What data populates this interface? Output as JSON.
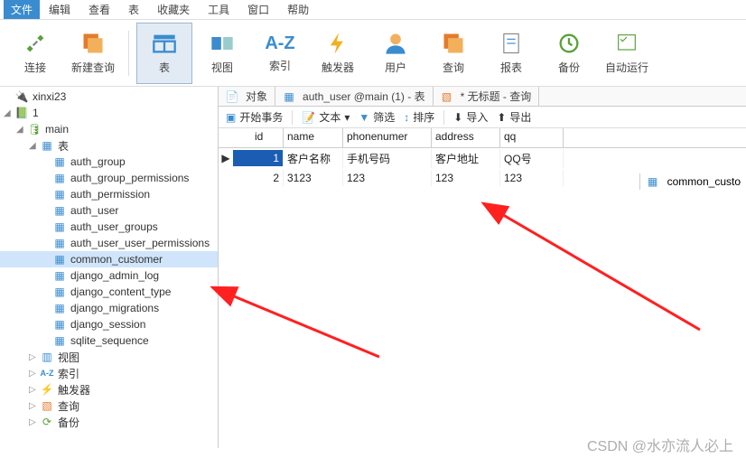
{
  "menu": {
    "file": "文件",
    "edit": "编辑",
    "view": "查看",
    "table": "表",
    "fav": "收藏夹",
    "tools": "工具",
    "window": "窗口",
    "help": "帮助"
  },
  "ribbon": {
    "connect": "连接",
    "newquery": "新建查询",
    "table": "表",
    "view": "视图",
    "atoz": "A-Z",
    "trigger": "触发器",
    "user": "用户",
    "query": "查询",
    "report": "报表",
    "backup": "备份",
    "autorun": "自动运行"
  },
  "tabs": {
    "object": "对象",
    "auth_user": "auth_user @main (1) - 表",
    "untitled": "* 无标题 - 查询",
    "right": "common_custo"
  },
  "tree": {
    "connection": "xinxi23",
    "db": "1",
    "schema": "main",
    "tables_label": "表",
    "tables": [
      "auth_group",
      "auth_group_permissions",
      "auth_permission",
      "auth_user",
      "auth_user_groups",
      "auth_user_user_permissions",
      "common_customer",
      "django_admin_log",
      "django_content_type",
      "django_migrations",
      "django_session",
      "sqlite_sequence"
    ],
    "views": "视图",
    "index": "索引",
    "trigger": "触发器",
    "query": "查询",
    "backup": "备份"
  },
  "toolbar": {
    "begin": "开始事务",
    "text": "文本",
    "filter": "筛选",
    "sort": "排序",
    "import": "导入",
    "export": "导出"
  },
  "grid": {
    "headers": {
      "id": "id",
      "name": "name",
      "phone": "phonenumer",
      "address": "address",
      "qq": "qq"
    },
    "rows": [
      {
        "id": "1",
        "name": "客户名称",
        "phone": "手机号码",
        "address": "客户地址",
        "qq": "QQ号"
      },
      {
        "id": "2",
        "name": "3123",
        "phone": "123",
        "address": "123",
        "qq": "123"
      }
    ]
  },
  "watermark": "CSDN @水亦流人必上"
}
